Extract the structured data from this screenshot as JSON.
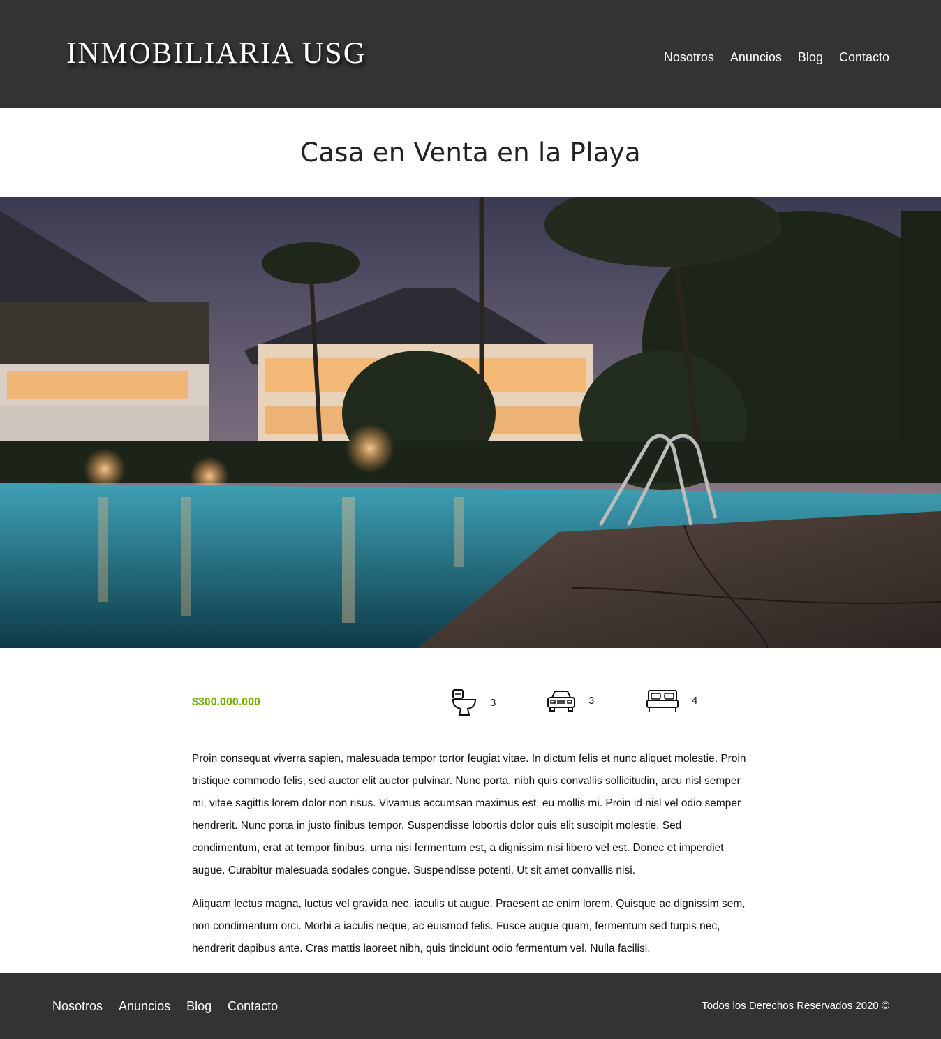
{
  "header": {
    "logo": "INMOBILIARIA USG",
    "nav": [
      "Nosotros",
      "Anuncios",
      "Blog",
      "Contacto"
    ]
  },
  "listing": {
    "title": "Casa en Venta en la Playa",
    "hero_image": "resort-pool-night-photo",
    "price": "$300.000.000",
    "price_color": "#71b100",
    "features": [
      {
        "icon": "toilet-icon",
        "count": "3"
      },
      {
        "icon": "car-icon",
        "count": "3"
      },
      {
        "icon": "bed-icon",
        "count": "4"
      }
    ],
    "paragraphs": [
      "Proin consequat viverra sapien, malesuada tempor tortor feugiat vitae. In dictum felis et nunc aliquet molestie. Proin tristique commodo felis, sed auctor elit auctor pulvinar. Nunc porta, nibh quis convallis sollicitudin, arcu nisl semper mi, vitae sagittis lorem dolor non risus. Vivamus accumsan maximus est, eu mollis mi. Proin id nisl vel odio semper hendrerit. Nunc porta in justo finibus tempor. Suspendisse lobortis dolor quis elit suscipit molestie. Sed condimentum, erat at tempor finibus, urna nisi fermentum est, a dignissim nisi libero vel est. Donec et imperdiet augue. Curabitur malesuada sodales congue. Suspendisse potenti. Ut sit amet convallis nisi.",
      "Aliquam lectus magna, luctus vel gravida nec, iaculis ut augue. Praesent ac enim lorem. Quisque ac dignissim sem, non condimentum orci. Morbi a iaculis neque, ac euismod felis. Fusce augue quam, fermentum sed turpis nec, hendrerit dapibus ante. Cras mattis laoreet nibh, quis tincidunt odio fermentum vel. Nulla facilisi."
    ]
  },
  "footer": {
    "nav": [
      "Nosotros",
      "Anuncios",
      "Blog",
      "Contacto"
    ],
    "copyright": "Todos los Derechos Reservados 2020 ©"
  },
  "colors": {
    "header_bg": "#333333",
    "footer_bg": "#333333"
  }
}
